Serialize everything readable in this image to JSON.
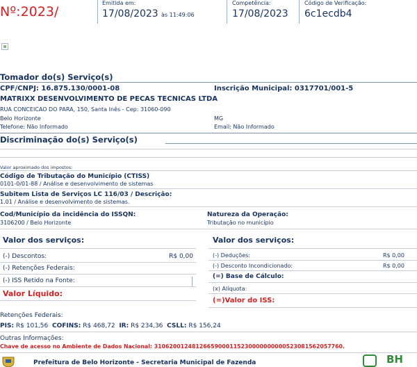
{
  "header": {
    "numero": "Nº:2023/",
    "emitida_label": "Emitida em:",
    "emitida_data": "17/08/2023",
    "emitida_hora": "às 11:49:06",
    "competencia_label": "Competência:",
    "competencia_data": "17/08/2023",
    "codigo_label": "Código de Verificação:",
    "codigo_valor": "6c1ecdb4"
  },
  "tomador": {
    "title": "Tomador do(s) Serviço(s)",
    "cpf_cnpj": "CPF/CNPJ: 16.875.130/0001-08",
    "inscricao": "Inscrição Municipal: 0317701/001-5",
    "razao_social": "MATRIXX DESENVOLVIMENTO DE PECAS TECNICAS LTDA",
    "endereco": "RUA CONCEICAO DO PARA, 150, Santa Inês - Cep: 31060-090",
    "cidade": "Belo Horizonte",
    "uf": "MG",
    "telefone": "Telefone: Não Informado",
    "email": "Email: Não Informado"
  },
  "discriminacao": {
    "title": "Discriminação do(s) Serviço(s)",
    "valor_impostos": "Valor aproximado dos impostos:",
    "ctiss_label": "Código de Tributação do Município (CTISS)",
    "ctiss_valor": "0101-0/01-88 / Análise e desenvolvimento de sistemas",
    "subitem_label": "Subitem Lista de Serviços LC 116/03 / Descrição:",
    "subitem_valor": "1.01 / Análise e desenvolvimento de sistemas.",
    "cod_municipio_label": "Cod/Município da incidência do ISSQN:",
    "cod_municipio_valor": "3106200 / Belo Horizonte",
    "natureza_label": "Natureza da Operação:",
    "natureza_valor": "Tributação no município"
  },
  "valores_left": {
    "title": "Valor dos serviços:",
    "descontos_label": "(-) Descontos:",
    "descontos_valor": "R$ 0,00",
    "retencoes_label": "(-) Retenções Federais:",
    "iss_retido_label": "(-) ISS Retido na Fonte:",
    "liquido_label": "Valor Líquido:"
  },
  "valores_right": {
    "title": "Valor dos serviços:",
    "deducoes_label": "(-) Deduções:",
    "deducoes_valor": "R$ 0,00",
    "desconto_incond_label": "(-) Desconto Incondicionado:",
    "desconto_incond_valor": "R$ 0,00",
    "base_label": "(=) Base de Cálculo:",
    "aliquota_label": "(x) Alíquota:",
    "valor_iss_label": "(=)Valor do ISS:"
  },
  "retencoes": {
    "title": "Retenções Federais:",
    "pis_label": "PIS:",
    "pis_valor": "R$ 101,56",
    "cofins_label": "COFINS:",
    "cofins_valor": "R$ 468,72",
    "ir_label": "IR:",
    "ir_valor": "R$ 234,36",
    "csll_label": "CSLL:",
    "csll_valor": "R$ 156,24"
  },
  "outras": {
    "title": "Outras Informações:",
    "chave": "Chave de acesso no Ambiente de Dados Nacional: 31062001248126659000115230000000000523081562057760."
  },
  "footer": {
    "prefeitura": "Prefeitura de Belo Horizonte - Secretaria Municipal de Fazenda",
    "logo_text": "BH"
  },
  "colors": {
    "navy": "#17325e",
    "red": "#d32020",
    "accent_green": "#2f8a3a"
  }
}
